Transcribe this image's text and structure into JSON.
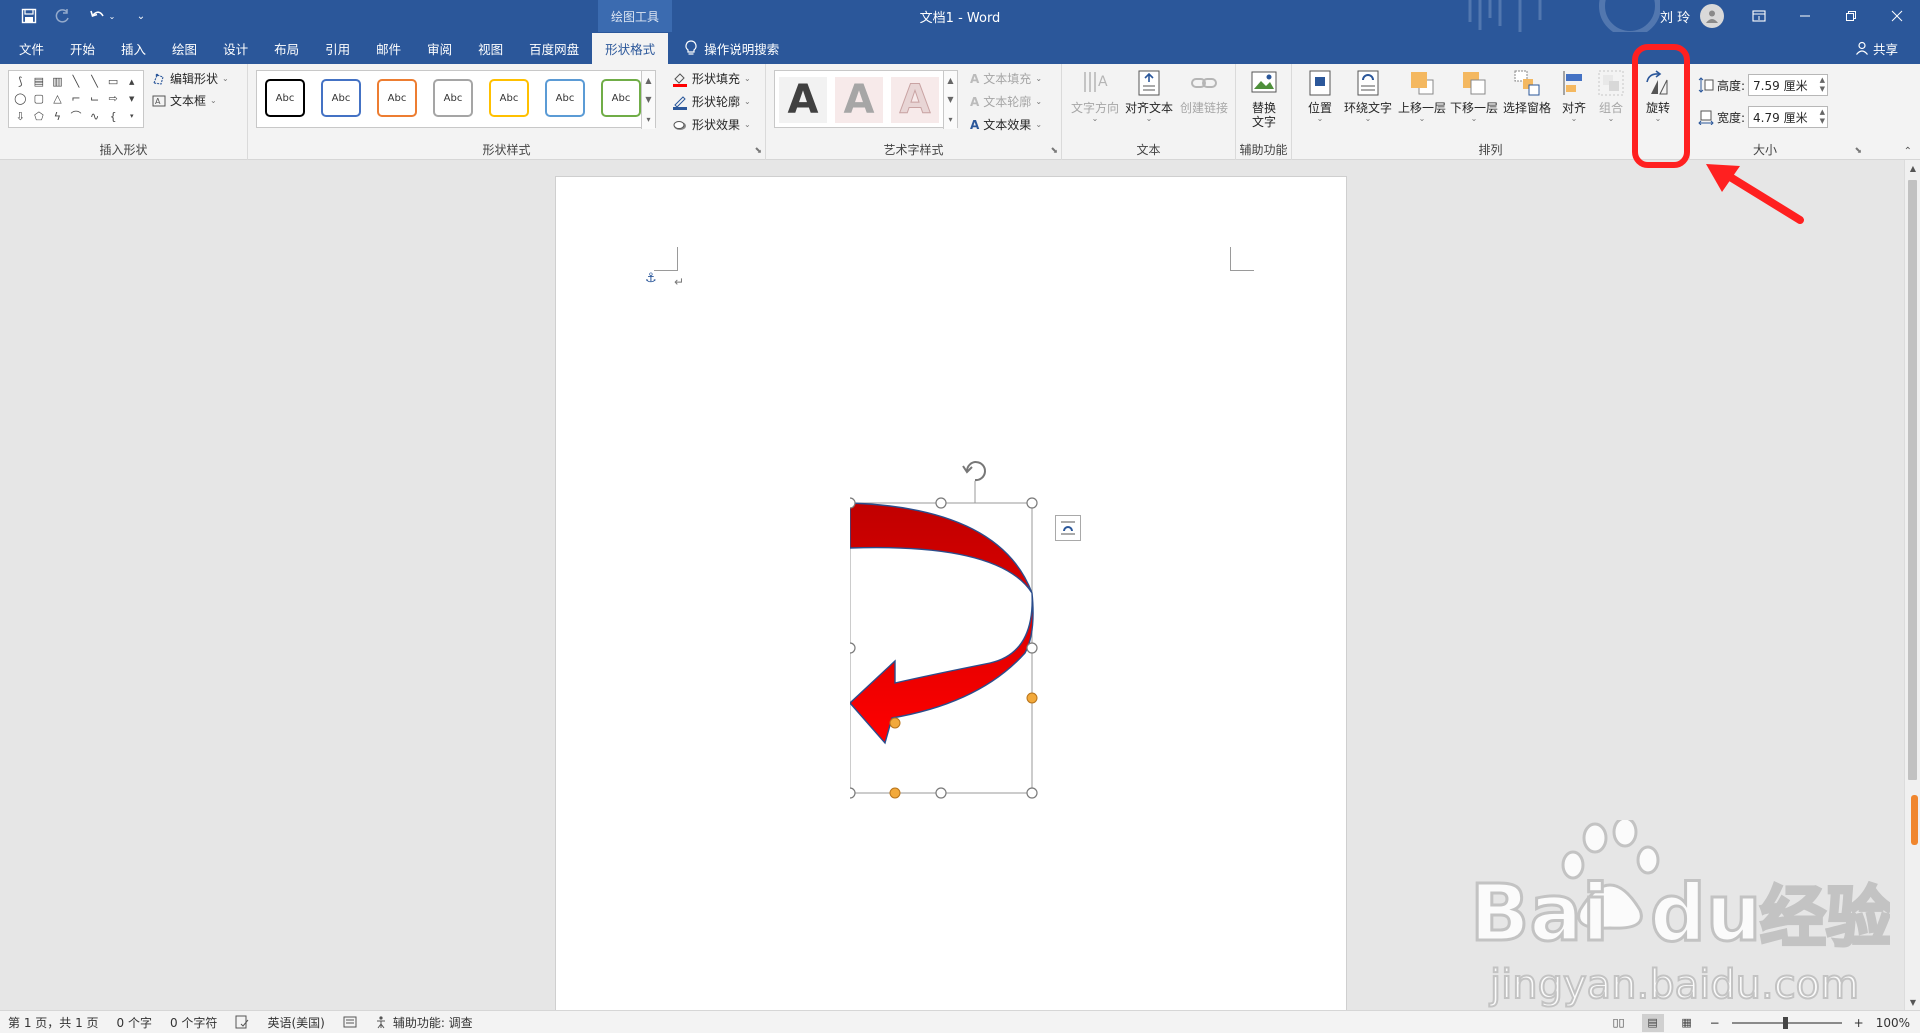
{
  "window": {
    "title": "文档1  -  Word",
    "contextual_group": "绘图工具",
    "user_name": "刘 玲",
    "share_label": "共享"
  },
  "tabs": [
    {
      "label": "文件"
    },
    {
      "label": "开始"
    },
    {
      "label": "插入"
    },
    {
      "label": "绘图"
    },
    {
      "label": "设计"
    },
    {
      "label": "布局"
    },
    {
      "label": "引用"
    },
    {
      "label": "邮件"
    },
    {
      "label": "审阅"
    },
    {
      "label": "视图"
    },
    {
      "label": "百度网盘"
    },
    {
      "label": "形状格式"
    }
  ],
  "active_tab": "形状格式",
  "tell_me": "操作说明搜索",
  "ribbon": {
    "insert_shapes": {
      "label": "插入形状",
      "edit_shape": "编辑形状",
      "text_box": "文本框"
    },
    "shape_styles": {
      "label": "形状样式",
      "swatch_text": "Abc",
      "swatch_colors": [
        "#000000",
        "#4472c4",
        "#ed7d31",
        "#a5a5a5",
        "#ffc000",
        "#5b9bd5",
        "#70ad47"
      ],
      "fill": "形状填充",
      "outline": "形状轮廓",
      "effects": "形状效果"
    },
    "wordart": {
      "label": "艺术字样式",
      "letter": "A",
      "text_fill": "文本填充",
      "text_outline": "文本轮廓",
      "text_effects": "文本效果"
    },
    "text": {
      "label": "文本",
      "text_direction": "文字方向",
      "align_text": "对齐文本",
      "create_link": "创建链接"
    },
    "accessibility": {
      "label": "辅助功能",
      "alt_text_line1": "替换",
      "alt_text_line2": "文字"
    },
    "arrange": {
      "label": "排列",
      "position": "位置",
      "wrap_text": "环绕文字",
      "bring_forward": "上移一层",
      "send_backward": "下移一层",
      "selection_pane": "选择窗格",
      "align": "对齐",
      "group": "组合",
      "rotate": "旋转"
    },
    "size": {
      "label": "大小",
      "height_label": "高度:",
      "height_value": "7.59 厘米",
      "width_label": "宽度:",
      "width_value": "4.79 厘米"
    }
  },
  "status": {
    "page": "第 1 页，共 1 页",
    "words": "0 个字",
    "chars": "0 个字符",
    "language": "英语(美国)",
    "accessibility": "辅助功能: 调查",
    "zoom": "100%"
  },
  "colors": {
    "brand": "#2b579a",
    "arrow_fill_top": "#c00000",
    "arrow_fill_bottom": "#ff0000",
    "annotation": "#ff2020"
  },
  "watermark": {
    "brand": "Bai",
    "brand2": "du",
    "cn": "经验",
    "url": "jingyan.baidu.com"
  }
}
